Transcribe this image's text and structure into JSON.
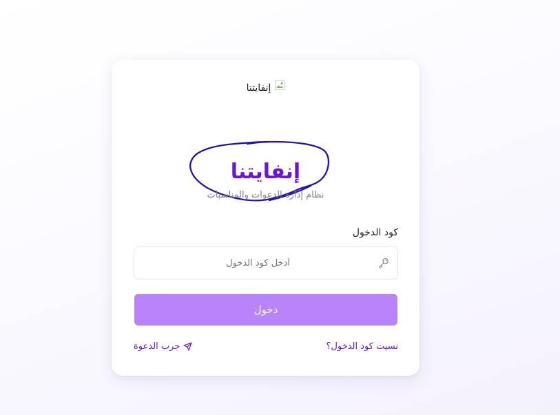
{
  "header": {
    "logo_alt": "إنفايتنا"
  },
  "brand": {
    "title": "إنفايتنا",
    "subtitle": "نظام إدارة الدعوات والمناسبات"
  },
  "login_form": {
    "field_label": "كود الدخول",
    "input_placeholder": "أدخل كود الدخول",
    "input_value": "",
    "submit_label": "دخول",
    "submit_icon": "key-icon"
  },
  "links": {
    "forgot_code": "نسيت كود الدخول؟",
    "try_invite": "جرب الدعوة",
    "try_invite_icon": "send-icon"
  },
  "colors": {
    "brand": "#6c14d6",
    "button": "#b983fb",
    "annotation": "#2f0fa8"
  }
}
